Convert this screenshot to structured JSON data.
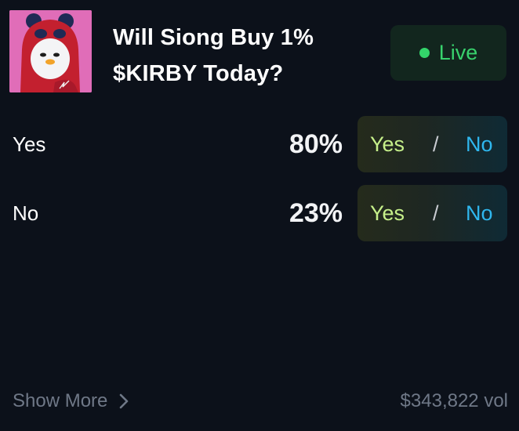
{
  "market": {
    "title": "Will Siong Buy 1% $KIRBY Today?",
    "thumbnail_icon": "kirby-penguin-avatar",
    "status_label": "Live",
    "status_color": "#33d46a"
  },
  "outcomes": [
    {
      "label": "Yes",
      "percent": "80%",
      "buy_yes": "Yes",
      "separator": "/",
      "buy_no": "No"
    },
    {
      "label": "No",
      "percent": "23%",
      "buy_yes": "Yes",
      "separator": "/",
      "buy_no": "No"
    }
  ],
  "footer": {
    "show_more_label": "Show More",
    "show_more_icon": "chevron-right-icon",
    "volume": "$343,822 vol"
  }
}
